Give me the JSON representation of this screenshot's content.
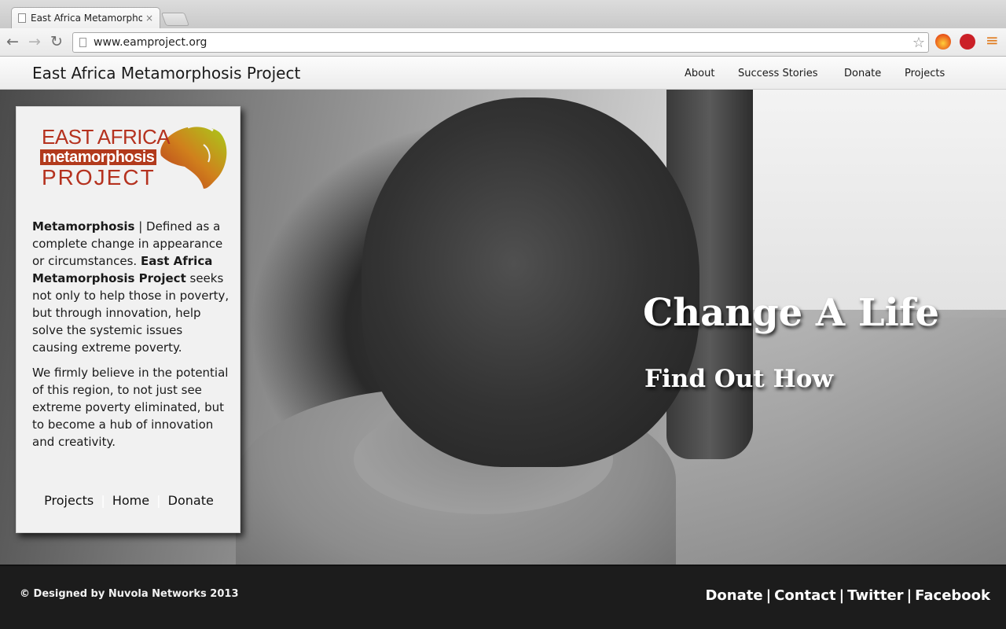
{
  "browser": {
    "tab_title": "East Africa Metamorphosis",
    "tab_close": "×",
    "url": "www.eamproject.org",
    "back": "←",
    "forward": "→",
    "reload": "↻",
    "star": "☆",
    "menu": "≡"
  },
  "header": {
    "brand": "East Africa Metamorphosis Project",
    "nav": [
      "About",
      "Success Stories",
      "Donate",
      "Projects"
    ]
  },
  "panel": {
    "logo": {
      "line1": "EAST AFRICA",
      "line2": "metamorphosis",
      "line3": "PROJECT"
    },
    "p1_bold": "Metamorphosis",
    "p1_text": " | Defined as a complete change in appearance or circumstances. ",
    "p1_bold2": "East Africa Metamorphosis Project",
    "p1_text2": " seeks not only to help those in poverty, but through innovation, help solve the systemic issues causing extreme poverty.",
    "p2": "We firmly believe in the potential of this region, to not just see extreme poverty eliminated, but to become a hub of innovation and creativity.",
    "links": [
      "Projects",
      "Home",
      "Donate"
    ],
    "separator": "|"
  },
  "hero": {
    "title": "Change A Life",
    "link": "Find Out How"
  },
  "footer": {
    "copyright": "© Designed by Nuvola Networks 2013",
    "links": [
      "Donate",
      "Contact",
      "Twitter",
      "Facebook"
    ],
    "separator": "|"
  },
  "colors": {
    "logo_red": "#b5321f",
    "footer_bg": "#1c1c1c",
    "panel_bg": "#f1f1f1"
  }
}
